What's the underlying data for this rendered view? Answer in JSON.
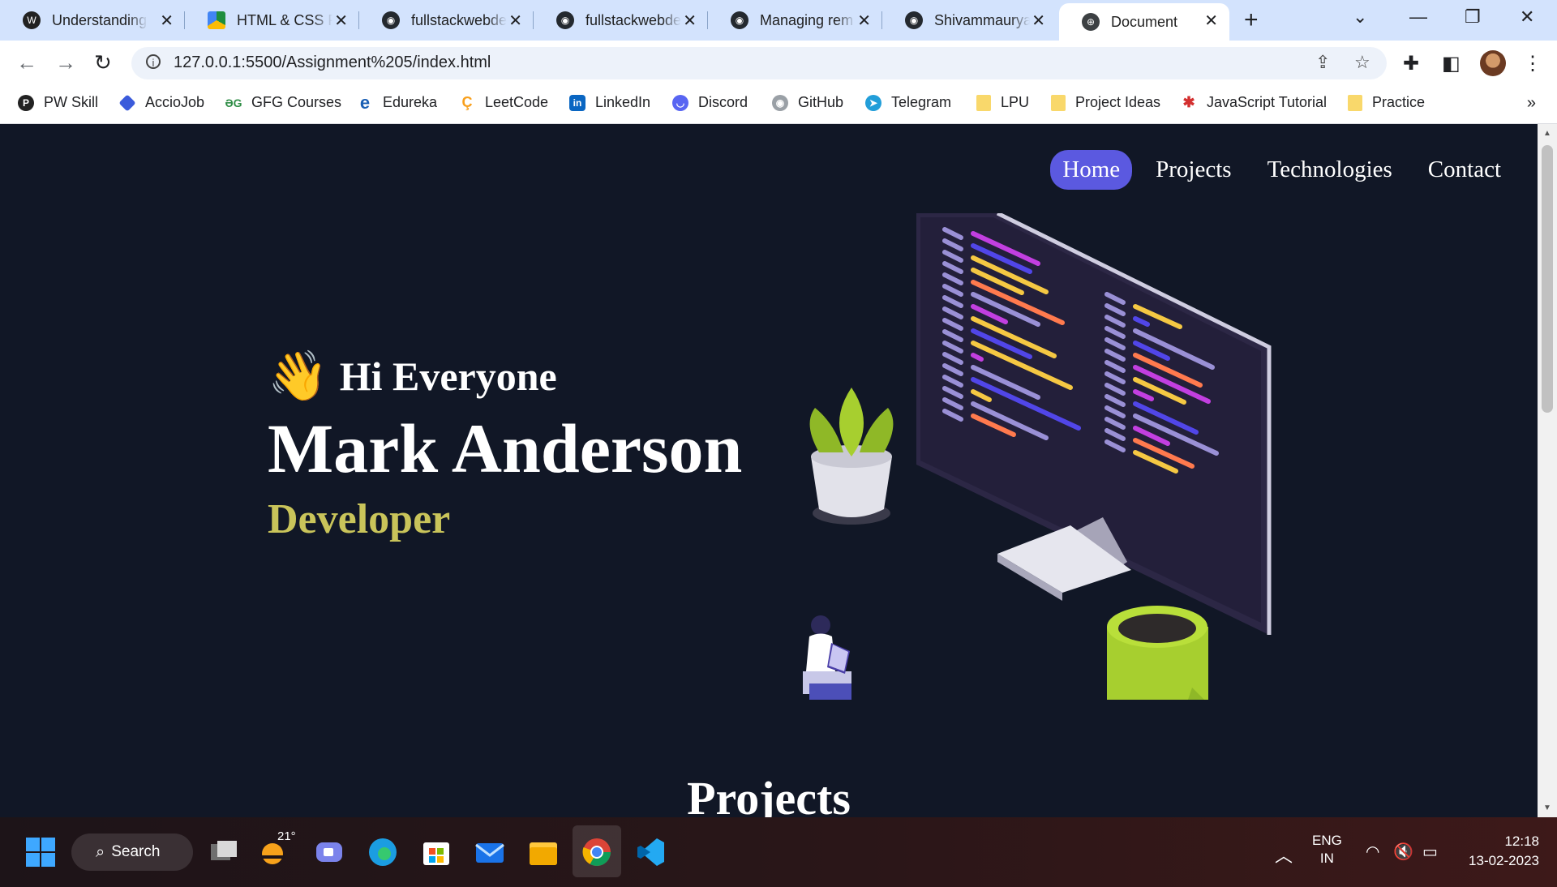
{
  "tabs": [
    {
      "title": "Understanding",
      "icon": "wordpress-icon"
    },
    {
      "title": "HTML & CSS P",
      "icon": "google-drive-icon"
    },
    {
      "title": "fullstackwebde",
      "icon": "github-icon"
    },
    {
      "title": "fullstackwebde",
      "icon": "github-icon"
    },
    {
      "title": "Managing rem",
      "icon": "github-icon"
    },
    {
      "title": "Shivammaurya",
      "icon": "github-icon"
    },
    {
      "title": "Document",
      "icon": "globe-icon",
      "active": true
    }
  ],
  "address": {
    "url": "127.0.0.1:5500/Assignment%205/index.html"
  },
  "bookmarks": [
    {
      "label": "PW Skill"
    },
    {
      "label": "AccioJob"
    },
    {
      "label": "GFG Courses"
    },
    {
      "label": "Edureka"
    },
    {
      "label": "LeetCode"
    },
    {
      "label": "LinkedIn"
    },
    {
      "label": "Discord"
    },
    {
      "label": "GitHub"
    },
    {
      "label": "Telegram"
    },
    {
      "label": "LPU"
    },
    {
      "label": "Project Ideas"
    },
    {
      "label": "JavaScript Tutorial"
    },
    {
      "label": "Practice"
    }
  ],
  "page": {
    "nav": [
      "Home",
      "Projects",
      "Technologies",
      "Contact"
    ],
    "hero": {
      "greeting": "Hi Everyone",
      "name": "Mark Anderson",
      "role": "Developer"
    },
    "projects_title": "Projects"
  },
  "taskbar": {
    "search_label": "Search",
    "weather": "21°",
    "lang_top": "ENG",
    "lang_bottom": "IN",
    "time": "12:18",
    "date": "13-02-2023"
  },
  "colors": {
    "page_bg": "#111726",
    "nav_active": "#5b59e0",
    "role": "#c9c45a",
    "tabstrip": "#d3e3fd"
  }
}
